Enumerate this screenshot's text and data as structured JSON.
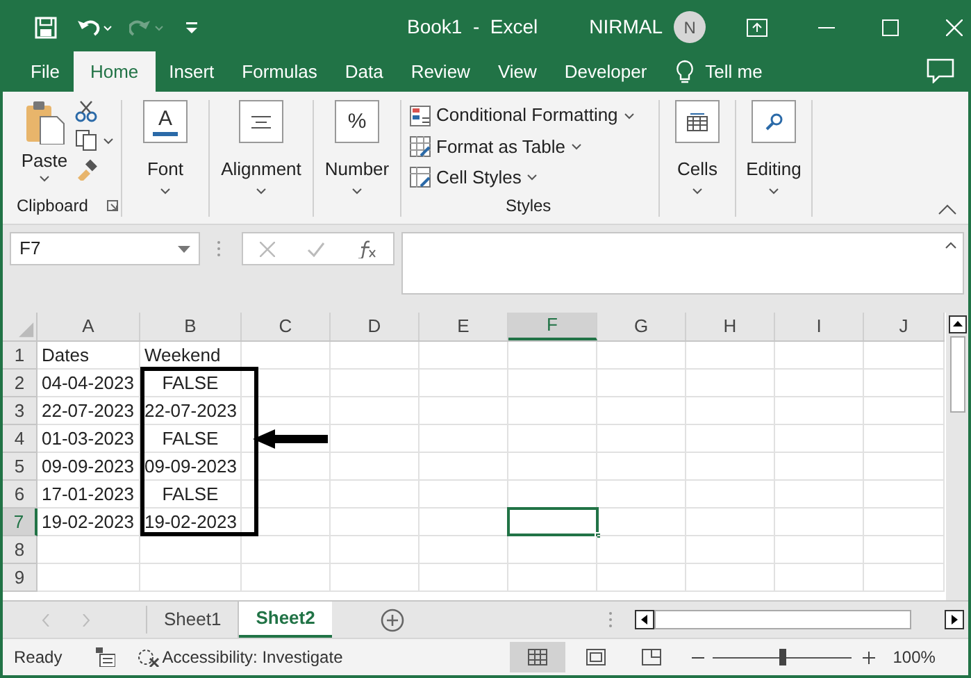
{
  "window": {
    "title": "Book1  -  Excel",
    "user": "NIRMAL",
    "avatar_initial": "N"
  },
  "menu_tabs": [
    {
      "label": "File",
      "selected": false
    },
    {
      "label": "Home",
      "selected": true
    },
    {
      "label": "Insert",
      "selected": false
    },
    {
      "label": "Formulas",
      "selected": false
    },
    {
      "label": "Data",
      "selected": false
    },
    {
      "label": "Review",
      "selected": false
    },
    {
      "label": "View",
      "selected": false
    },
    {
      "label": "Developer",
      "selected": false
    }
  ],
  "tell_me": "Tell me",
  "ribbon": {
    "clipboard": {
      "paste": "Paste",
      "label": "Clipboard"
    },
    "big_buttons": [
      {
        "label": "Font",
        "kind": "font",
        "glyph": "A"
      },
      {
        "label": "Alignment",
        "kind": "align"
      },
      {
        "label": "Number",
        "kind": "number",
        "glyph": "%"
      }
    ],
    "styles": {
      "items": [
        "Conditional Formatting",
        "Format as Table",
        "Cell Styles"
      ],
      "label": "Styles"
    },
    "right_buttons": [
      {
        "label": "Cells",
        "kind": "cells"
      },
      {
        "label": "Editing",
        "kind": "editing"
      }
    ]
  },
  "name_box": "F7",
  "columns": [
    {
      "label": "A",
      "selected": false
    },
    {
      "label": "B",
      "selected": false
    },
    {
      "label": "C",
      "selected": false
    },
    {
      "label": "D",
      "selected": false
    },
    {
      "label": "E",
      "selected": false
    },
    {
      "label": "F",
      "selected": true
    },
    {
      "label": "G",
      "selected": false
    },
    {
      "label": "H",
      "selected": false
    },
    {
      "label": "I",
      "selected": false
    },
    {
      "label": "J",
      "selected": false
    }
  ],
  "rows": [
    {
      "label": "1",
      "selected": false,
      "cells": [
        {
          "text": "Dates",
          "kind": "text"
        },
        {
          "text": "Weekend",
          "kind": "text"
        }
      ]
    },
    {
      "label": "2",
      "selected": false,
      "cells": [
        {
          "text": "04-04-2023",
          "kind": "text"
        },
        {
          "text": "FALSE",
          "kind": "boolean"
        }
      ]
    },
    {
      "label": "3",
      "selected": false,
      "cells": [
        {
          "text": "22-07-2023",
          "kind": "text"
        },
        {
          "text": "22-07-2023",
          "kind": "text"
        }
      ]
    },
    {
      "label": "4",
      "selected": false,
      "cells": [
        {
          "text": "01-03-2023",
          "kind": "text"
        },
        {
          "text": "FALSE",
          "kind": "boolean"
        }
      ]
    },
    {
      "label": "5",
      "selected": false,
      "cells": [
        {
          "text": "09-09-2023",
          "kind": "text"
        },
        {
          "text": "09-09-2023",
          "kind": "text"
        }
      ]
    },
    {
      "label": "6",
      "selected": false,
      "cells": [
        {
          "text": "17-01-2023",
          "kind": "text"
        },
        {
          "text": "FALSE",
          "kind": "boolean"
        }
      ]
    },
    {
      "label": "7",
      "selected": true,
      "cells": [
        {
          "text": "19-02-2023",
          "kind": "text"
        },
        {
          "text": "19-02-2023",
          "kind": "text"
        }
      ]
    },
    {
      "label": "8",
      "selected": false,
      "cells": []
    },
    {
      "label": "9",
      "selected": false,
      "cells": []
    }
  ],
  "sheets": [
    {
      "label": "Sheet1",
      "selected": false
    },
    {
      "label": "Sheet2",
      "selected": true
    }
  ],
  "status_bar": {
    "status": "Ready",
    "accessibility": "Accessibility: Investigate",
    "zoom": "100%",
    "zoom_slider": {
      "level": 0.5
    }
  }
}
